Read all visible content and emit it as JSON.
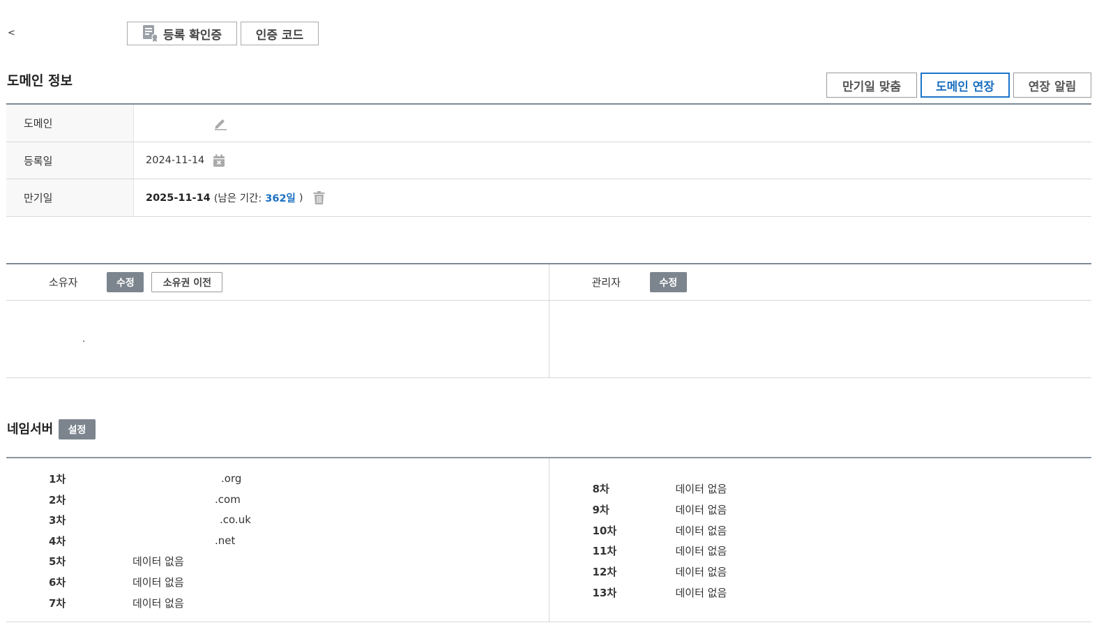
{
  "top": {
    "back_label": "<",
    "cert_button": "등록 확인증",
    "auth_code_button": "인증 코드"
  },
  "domain_info": {
    "title": "도메인 정보",
    "buttons": {
      "sync_expiry": "만기일 맞춤",
      "renew": "도메인 연장",
      "renew_notice": "연장 알림"
    },
    "rows": {
      "domain_label": "도메인",
      "domain_value": "",
      "registered_label": "등록일",
      "registered_value": "2024-11-14",
      "expiry_label": "만기일",
      "expiry_value": "2025-11-14",
      "remaining_prefix": "(남은 기간:",
      "remaining_days": "362일",
      "remaining_suffix": ")"
    }
  },
  "contacts": {
    "owner_label": "소유자",
    "owner_edit": "수정",
    "owner_transfer": "소유권 이전",
    "owner_value": ".",
    "admin_label": "관리자",
    "admin_edit": "수정"
  },
  "nameservers": {
    "title": "네임서버",
    "setup_button": "설정",
    "left": [
      {
        "index": "1차",
        "value": ".org"
      },
      {
        "index": "2차",
        "value": ".com"
      },
      {
        "index": "3차",
        "value": ".co.uk"
      },
      {
        "index": "4차",
        "value": ".net"
      },
      {
        "index": "5차",
        "value": "데이터 없음"
      },
      {
        "index": "6차",
        "value": "데이터 없음"
      },
      {
        "index": "7차",
        "value": "데이터 없음"
      }
    ],
    "right": [
      {
        "index": "8차",
        "value": "데이터 없음"
      },
      {
        "index": "9차",
        "value": "데이터 없음"
      },
      {
        "index": "10차",
        "value": "데이터 없음"
      },
      {
        "index": "11차",
        "value": "데이터 없음"
      },
      {
        "index": "12차",
        "value": "데이터 없음"
      },
      {
        "index": "13차",
        "value": "데이터 없음"
      }
    ]
  },
  "colors": {
    "accent_blue": "#1a6fc0",
    "gray_button": "#7c858e",
    "table_border": "#7d8a96"
  }
}
